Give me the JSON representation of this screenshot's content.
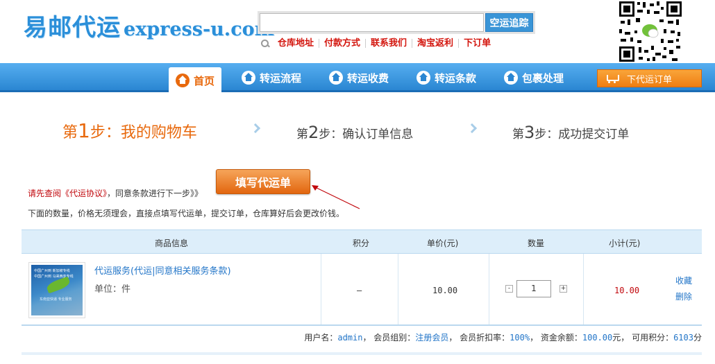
{
  "logo": {
    "cn": "易邮代运",
    "en": "express-u.com"
  },
  "search": {
    "placeholder": "",
    "button": "空运追踪"
  },
  "quick_links": [
    "仓库地址",
    "付款方式",
    "联系我们",
    "淘宝返利",
    "下订单"
  ],
  "nav": {
    "items": [
      "首页",
      "转运流程",
      "转运收费",
      "转运条款",
      "包裹处理"
    ],
    "active": "首页",
    "order_button": "下代运订单"
  },
  "steps": [
    {
      "prefix": "第",
      "num": "1",
      "suffix": "步：我的购物车",
      "active": true
    },
    {
      "prefix": "第",
      "num": "2",
      "suffix": "步：确认订单信息",
      "active": false
    },
    {
      "prefix": "第",
      "num": "3",
      "suffix": "步：成功提交订单",
      "active": false
    }
  ],
  "notice": {
    "part1": "请先查阅《代运协议》",
    "part2": "，同意条款进行下一步》》"
  },
  "fill_button": "填写代运单",
  "note2": "下面的数量，价格无须理会，直接点填写代运单，提交订单，仓库算好后会更改价钱。",
  "table": {
    "headers": [
      "商品信息",
      "积分",
      "单价(元)",
      "数量",
      "小计(元)"
    ],
    "row": {
      "thumb_text": [
        "中国广州到 新加坡专线",
        "中国广州到 马来西亚专线",
        "东南亚快递 专业服务"
      ],
      "name": "代运服务(代运|同意相关服务条款)",
      "unit": "单位：件",
      "points": "—",
      "price": "10.00",
      "qty_minus": "-",
      "qty": "1",
      "qty_plus": "+",
      "subtotal": "10.00",
      "fav": "收藏",
      "del": "删除"
    }
  },
  "summary": {
    "user_label": "用户名：",
    "user": "admin",
    "group_label": "，  会员组别：",
    "group": "注册会员",
    "discount_label": "，  会员折扣率：",
    "discount": "100%",
    "balance_label": "，  资金余额：",
    "balance": "100.00",
    "balance_unit": "元，  可用积分：",
    "points": "6103",
    "points_unit": "分"
  },
  "colors": {
    "brand_blue": "#2b8fd9",
    "accent_orange": "#e8690d",
    "link_red": "#d3140c"
  }
}
